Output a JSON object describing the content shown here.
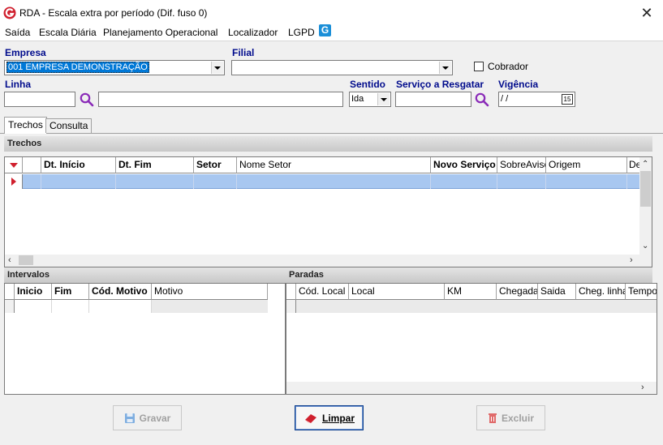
{
  "window": {
    "title": "RDA - Escala extra por período (Dif. fuso 0)"
  },
  "menu": [
    "Saída",
    "Escala Diária",
    "Planejamento Operacional",
    "Localizador",
    "LGPD"
  ],
  "form": {
    "empresa_label": "Empresa",
    "empresa_value": "001 EMPRESA DEMONSTRAÇÃO",
    "filial_label": "Filial",
    "filial_value": "",
    "cobrador_label": "Cobrador",
    "linha_label": "Linha",
    "linha_code": "",
    "linha_desc": "",
    "sentido_label": "Sentido",
    "sentido_value": "Ida",
    "servico_label": "Serviço a Resgatar",
    "servico_value": "",
    "vigencia_label": "Vigência",
    "vigencia_value": " / /",
    "calendar_label": "15"
  },
  "tabs": [
    "Trechos",
    "Consulta"
  ],
  "trechos": {
    "header": "Trechos",
    "columns": [
      "Dt. Início",
      "Dt. Fim",
      "Setor",
      "Nome Setor",
      "Novo Serviço",
      "SobreAviso",
      "Origem",
      "De"
    ]
  },
  "intervalos": {
    "header": "Intervalos",
    "columns": [
      "Inicio",
      "Fim",
      "Cód. Motivo",
      "Motivo"
    ]
  },
  "paradas": {
    "header": "Paradas",
    "columns": [
      "Cód. Local",
      "Local",
      "KM",
      "Chegada",
      "Saida",
      "Cheg. linha",
      "Tempo"
    ]
  },
  "buttons": {
    "gravar": "Gravar",
    "limpar": "Limpar",
    "excluir": "Excluir"
  },
  "colors": {
    "label_blue": "#000b8c",
    "selection_blue": "#0078d7",
    "row_highlight": "#a8c7f0",
    "logo_red": "#d0202e",
    "lgpd_blue": "#1b8fd8"
  }
}
